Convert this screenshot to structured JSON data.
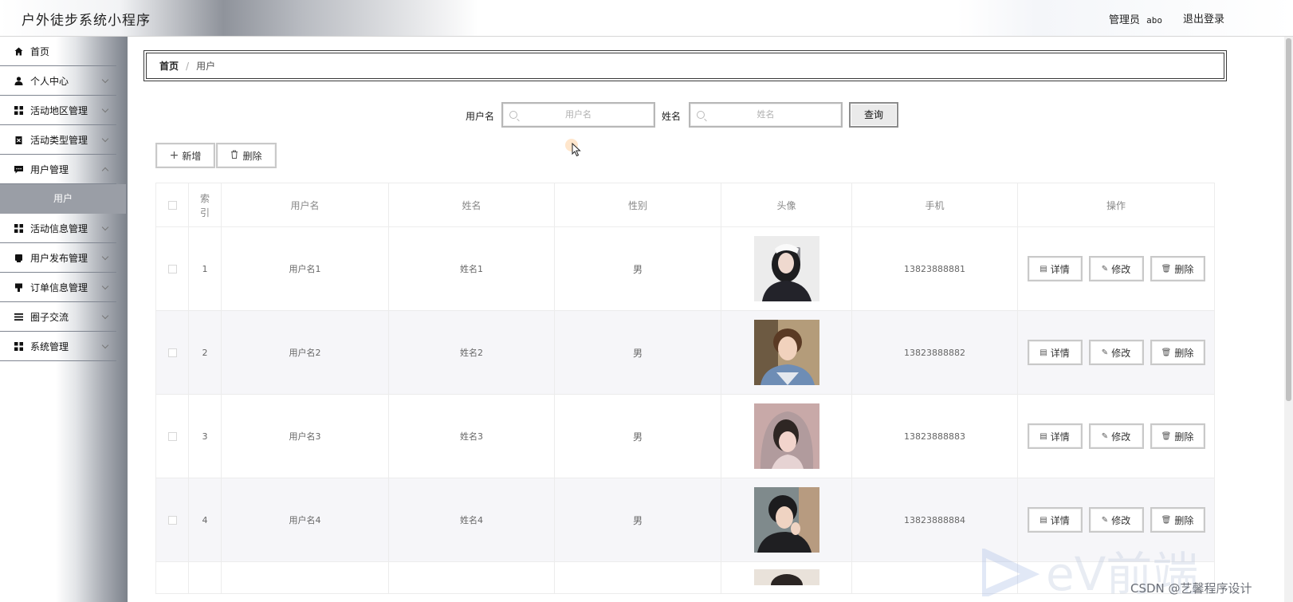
{
  "header": {
    "title": "户外徒步系统小程序",
    "role": "管理员",
    "username": "abo",
    "logout": "退出登录"
  },
  "sidebar": {
    "items": [
      {
        "label": "首页",
        "icon": "home-icon"
      },
      {
        "label": "个人中心",
        "icon": "user-icon"
      },
      {
        "label": "活动地区管理",
        "icon": "grid-icon"
      },
      {
        "label": "活动类型管理",
        "icon": "clipboard-icon"
      },
      {
        "label": "用户管理",
        "icon": "chat-icon"
      },
      {
        "label": "活动信息管理",
        "icon": "grid-icon"
      },
      {
        "label": "用户发布管理",
        "icon": "mobile-icon"
      },
      {
        "label": "订单信息管理",
        "icon": "marker-icon"
      },
      {
        "label": "圈子交流",
        "icon": "list-icon"
      },
      {
        "label": "系统管理",
        "icon": "grid-icon"
      }
    ],
    "active_sub": "用户"
  },
  "breadcrumb": {
    "home": "首页",
    "separator": "/",
    "current": "用户"
  },
  "search": {
    "username_label": "用户名",
    "username_placeholder": "用户名",
    "name_label": "姓名",
    "name_placeholder": "姓名",
    "query_button": "查询"
  },
  "toolbar": {
    "add": "新增",
    "delete": "删除"
  },
  "table": {
    "headers": [
      "索引",
      "用户名",
      "姓名",
      "性别",
      "头像",
      "手机",
      "操作"
    ],
    "rows": [
      {
        "index": "1",
        "username": "用户名1",
        "name": "姓名1",
        "gender": "男",
        "phone": "13823888881"
      },
      {
        "index": "2",
        "username": "用户名2",
        "name": "姓名2",
        "gender": "男",
        "phone": "13823888882"
      },
      {
        "index": "3",
        "username": "用户名3",
        "name": "姓名3",
        "gender": "男",
        "phone": "13823888883"
      },
      {
        "index": "4",
        "username": "用户名4",
        "name": "姓名4",
        "gender": "男",
        "phone": "13823888884"
      }
    ],
    "actions": {
      "detail": "详情",
      "edit": "修改",
      "delete": "删除"
    }
  },
  "watermark": "CSDN @艺馨程序设计",
  "colors": {
    "sidebar_active": "#9a9ea6",
    "border": "#c9c9c9",
    "table_stripe": "#f6f6f9"
  }
}
